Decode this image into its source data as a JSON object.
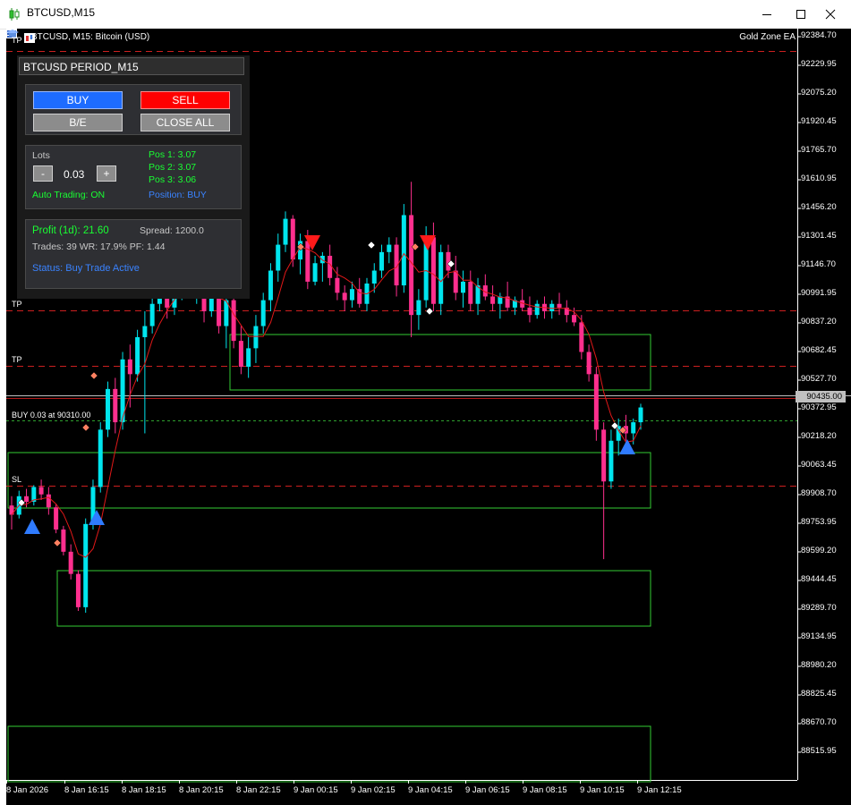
{
  "window": {
    "title": "BTCUSD,M15"
  },
  "chart_header": {
    "symbol_label": "BTCUSD, M15:  Bitcoin (USD)",
    "ea_label": "Gold Zone EA"
  },
  "price_axis": [
    "92384.70",
    "92229.95",
    "92075.20",
    "91920.45",
    "91765.70",
    "91610.95",
    "91456.20",
    "91301.45",
    "91146.70",
    "90991.95",
    "90837.20",
    "90682.45",
    "90527.70",
    "90372.95",
    "90218.20",
    "90063.45",
    "89908.70",
    "89753.95",
    "89599.20",
    "89444.45",
    "89289.70",
    "89134.95",
    "88980.20",
    "88825.45",
    "88670.70",
    "88515.95"
  ],
  "current_price": "90435.00",
  "time_axis": [
    "8 Jan 2026",
    "8 Jan 16:15",
    "8 Jan 18:15",
    "8 Jan 20:15",
    "8 Jan 22:15",
    "9 Jan 00:15",
    "9 Jan 02:15",
    "9 Jan 04:15",
    "9 Jan 06:15",
    "9 Jan 08:15",
    "9 Jan 10:15",
    "9 Jan 12:15"
  ],
  "levels": {
    "tp1": "TP",
    "tp2": "TP",
    "tp3": "TP",
    "sl": "SL",
    "buy_line": "BUY 0.03 at 90310.00"
  },
  "panel": {
    "title": "BTCUSD PERIOD_M15",
    "buttons": {
      "buy": "BUY",
      "sell": "SELL",
      "be": "B/E",
      "close_all": "CLOSE ALL"
    },
    "lots_label": "Lots",
    "minus": "-",
    "plus": "+",
    "lots_value": "0.03",
    "positions": [
      "Pos 1: 3.07",
      "Pos 2: 3.07",
      "Pos 3: 3.06"
    ],
    "auto_trading": "Auto Trading: ON",
    "position": "Position: BUY",
    "profit": "Profit (1d): 21.60",
    "spread": "Spread: 1200.0",
    "trades": "Trades: 39  WR: 17.9%  PF: 1.44",
    "status": "Status: Buy Trade Active"
  },
  "colors": {
    "bull": "#00e5ee",
    "bear": "#ff2f8e",
    "zone": "#33cc33",
    "level": "#cc1f1f",
    "ma": "#e01818"
  },
  "chart_data": {
    "type": "candlestick",
    "title": "BTCUSD, M15",
    "x_range": [
      "8 Jan 2026",
      "9 Jan 12:15"
    ],
    "y_range": [
      88450,
      92430
    ],
    "current_price": 90435.0,
    "ohlc": [
      [
        89850,
        89900,
        89720,
        89800
      ],
      [
        89800,
        89930,
        89780,
        89900
      ],
      [
        89900,
        89940,
        89840,
        89870
      ],
      [
        89870,
        89960,
        89850,
        89950
      ],
      [
        89950,
        89990,
        89880,
        89910
      ],
      [
        89910,
        89950,
        89800,
        89840
      ],
      [
        89840,
        89860,
        89700,
        89720
      ],
      [
        89720,
        89740,
        89580,
        89600
      ],
      [
        89600,
        89640,
        89450,
        89480
      ],
      [
        89480,
        89500,
        89280,
        89300
      ],
      [
        89300,
        89780,
        89270,
        89750
      ],
      [
        89750,
        89990,
        89720,
        89950
      ],
      [
        89950,
        90300,
        89920,
        90260
      ],
      [
        90260,
        90520,
        90220,
        90480
      ],
      [
        90480,
        90540,
        90240,
        90300
      ],
      [
        90300,
        90680,
        90260,
        90640
      ],
      [
        90640,
        90720,
        90380,
        90560
      ],
      [
        90560,
        90800,
        90520,
        90760
      ],
      [
        90760,
        90900,
        90240,
        90820
      ],
      [
        90820,
        90980,
        90780,
        90940
      ],
      [
        90940,
        91120,
        90900,
        91080
      ],
      [
        91080,
        91140,
        90860,
        90920
      ],
      [
        90920,
        91100,
        90880,
        91060
      ],
      [
        91060,
        91200,
        90960,
        91160
      ],
      [
        91160,
        91260,
        90980,
        91040
      ],
      [
        91040,
        91180,
        90940,
        91100
      ],
      [
        91100,
        91140,
        90840,
        90900
      ],
      [
        90900,
        91050,
        90870,
        91000
      ],
      [
        91000,
        91080,
        90780,
        90820
      ],
      [
        90820,
        91000,
        90700,
        90960
      ],
      [
        90960,
        91020,
        90700,
        90740
      ],
      [
        90740,
        90820,
        90560,
        90600
      ],
      [
        90600,
        90760,
        90540,
        90700
      ],
      [
        90700,
        90880,
        90620,
        90820
      ],
      [
        90820,
        91000,
        90780,
        90960
      ],
      [
        90960,
        91160,
        90900,
        91120
      ],
      [
        91120,
        91320,
        91060,
        91260
      ],
      [
        91260,
        91440,
        91220,
        91400
      ],
      [
        91400,
        91420,
        91140,
        91180
      ],
      [
        91180,
        91320,
        91100,
        91280
      ],
      [
        91280,
        91340,
        91020,
        91060
      ],
      [
        91060,
        91200,
        91040,
        91160
      ],
      [
        91160,
        91220,
        91060,
        91200
      ],
      [
        91200,
        91260,
        91040,
        91080
      ],
      [
        91080,
        91140,
        90960,
        91000
      ],
      [
        91000,
        91040,
        90900,
        90960
      ],
      [
        90960,
        91060,
        90920,
        91020
      ],
      [
        91020,
        91080,
        90920,
        90940
      ],
      [
        90940,
        91080,
        90900,
        91050
      ],
      [
        91050,
        91160,
        91000,
        91120
      ],
      [
        91120,
        91260,
        91080,
        91220
      ],
      [
        91220,
        91300,
        91160,
        91260
      ],
      [
        91260,
        91300,
        90980,
        91040
      ],
      [
        91040,
        91480,
        91000,
        91420
      ],
      [
        91420,
        91600,
        90760,
        90880
      ],
      [
        90880,
        91020,
        90800,
        90960
      ],
      [
        90960,
        91360,
        90920,
        91300
      ],
      [
        91300,
        91380,
        90900,
        90940
      ],
      [
        90940,
        91260,
        90880,
        91220
      ],
      [
        91220,
        91260,
        91080,
        91120
      ],
      [
        91120,
        91200,
        90960,
        91000
      ],
      [
        91000,
        91120,
        90920,
        91060
      ],
      [
        91060,
        91120,
        90900,
        90940
      ],
      [
        90940,
        91080,
        90880,
        91040
      ],
      [
        91040,
        91100,
        90960,
        90980
      ],
      [
        90980,
        91040,
        90900,
        90940
      ],
      [
        90940,
        91000,
        90860,
        90980
      ],
      [
        90980,
        91060,
        90900,
        90920
      ],
      [
        90920,
        90980,
        90880,
        90960
      ],
      [
        90960,
        91020,
        90900,
        90920
      ],
      [
        90920,
        90980,
        90840,
        90880
      ],
      [
        90880,
        90960,
        90860,
        90940
      ],
      [
        90940,
        90980,
        90860,
        90900
      ],
      [
        90900,
        90960,
        90860,
        90940
      ],
      [
        90940,
        91000,
        90880,
        90920
      ],
      [
        90920,
        90960,
        90840,
        90880
      ],
      [
        90880,
        90920,
        90820,
        90840
      ],
      [
        90840,
        90880,
        90640,
        90680
      ],
      [
        90680,
        90720,
        90520,
        90560
      ],
      [
        90560,
        90600,
        90200,
        90260
      ],
      [
        90260,
        90300,
        89560,
        89980
      ],
      [
        89980,
        90260,
        89940,
        90200
      ],
      [
        90200,
        90320,
        90120,
        90280
      ],
      [
        90280,
        90340,
        90200,
        90240
      ],
      [
        90240,
        90320,
        90180,
        90300
      ],
      [
        90300,
        90400,
        90260,
        90380
      ]
    ]
  }
}
